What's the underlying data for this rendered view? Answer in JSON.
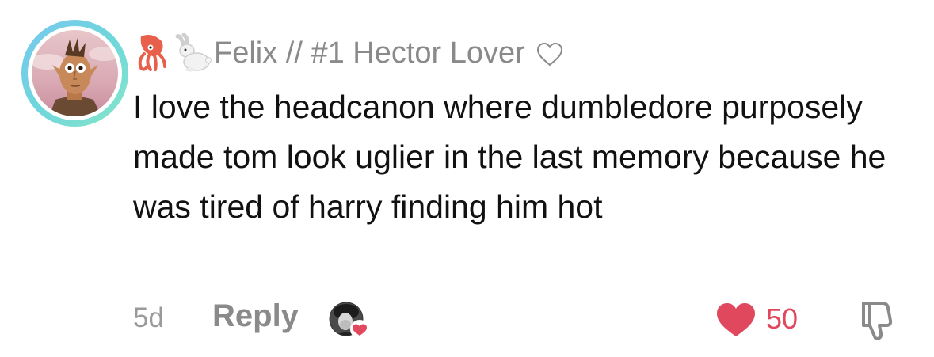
{
  "comment": {
    "username": "Felix // #1 Hector Lover",
    "username_emojis": [
      "squid-emoji",
      "rabbit-emoji"
    ],
    "text": "I love the headcanon where dumbledore purposely made tom look uglier in the last memory because he was tired of harry finding him hot",
    "timestamp": "5d",
    "reply_label": "Reply",
    "like_count": "50",
    "liked_by_creator": true
  },
  "colors": {
    "avatar_ring_start": "#79c8ef",
    "avatar_ring_end": "#86e6c8",
    "username": "#8a8a8a",
    "text": "#111111",
    "meta": "#9a9a9a",
    "like": "#e0485e"
  },
  "icons": {
    "header_heart": "heart-outline-icon",
    "like": "heart-filled-icon",
    "dislike": "thumbs-down-icon"
  }
}
